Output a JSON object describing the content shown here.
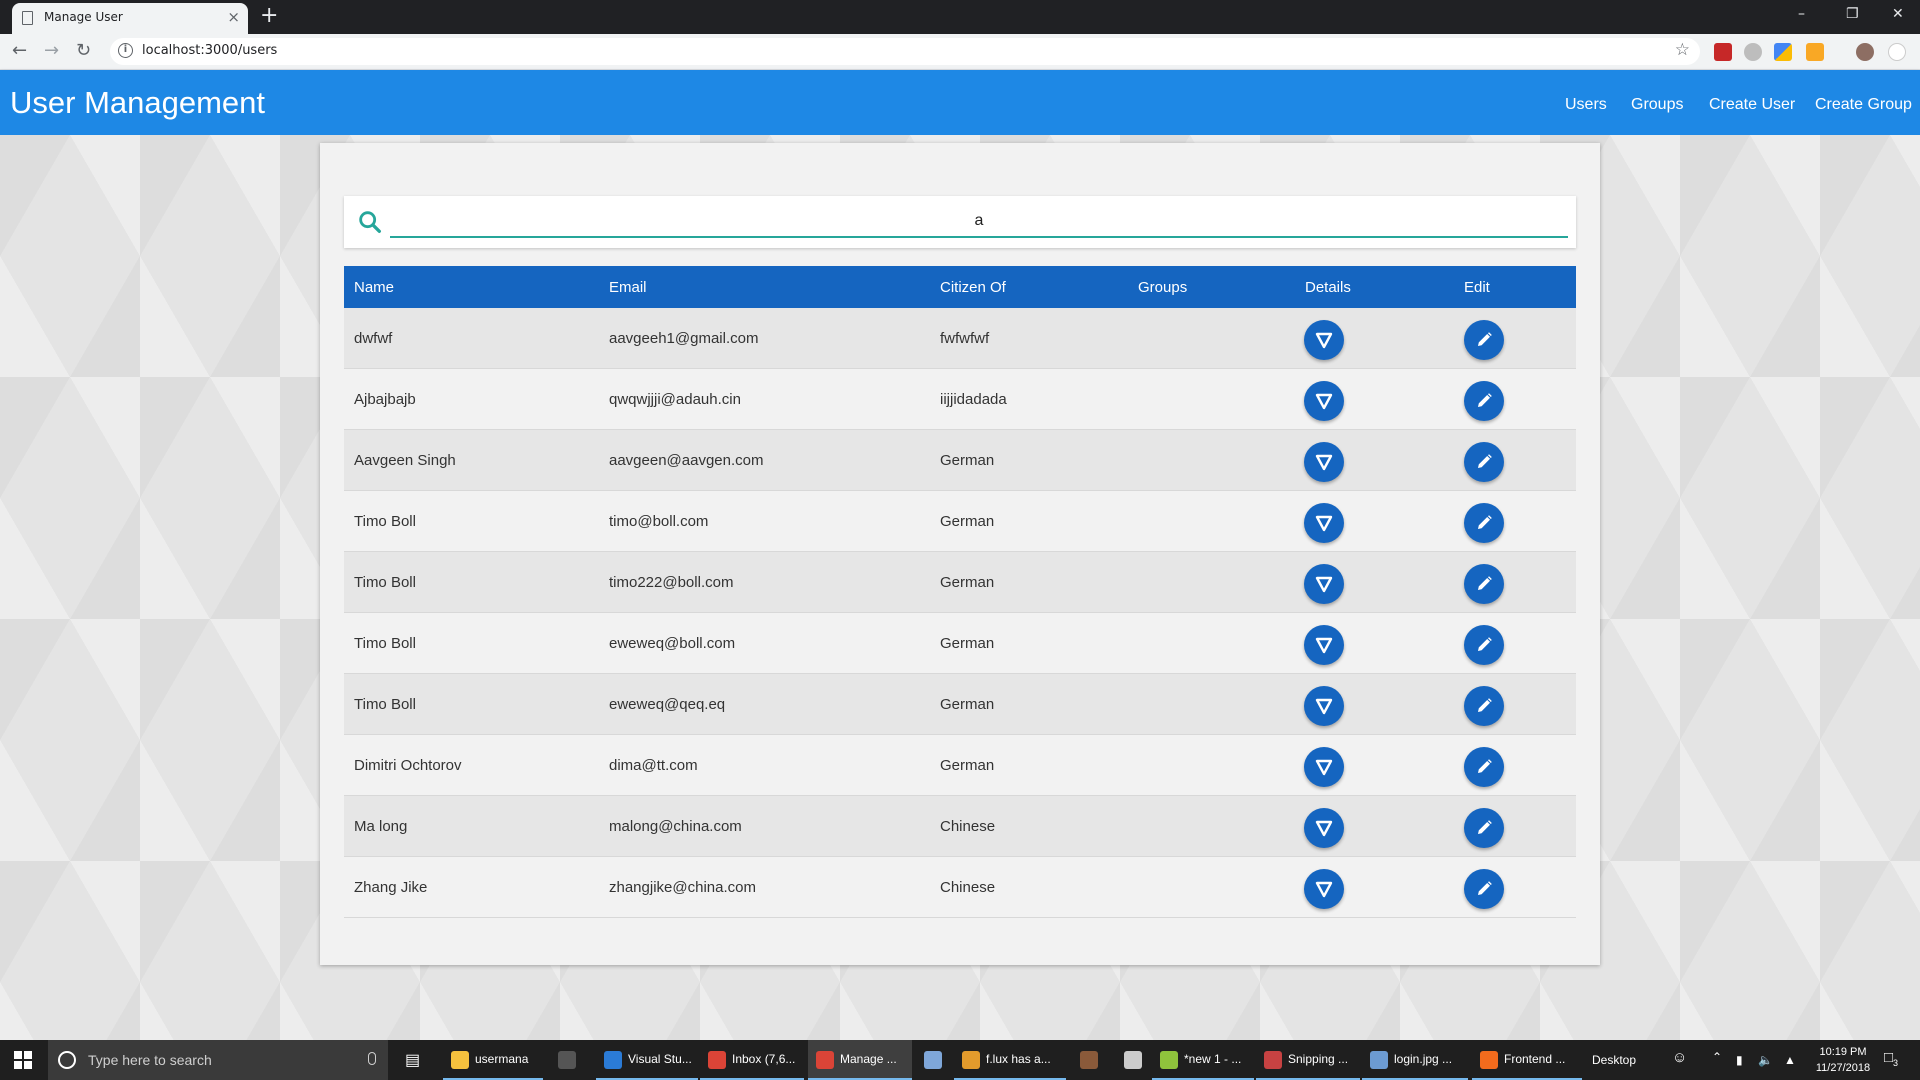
{
  "browser": {
    "tab_title": "Manage User",
    "tab_close": "×",
    "new_tab": "+",
    "url": "localhost:3000/users",
    "window_controls": [
      "–",
      "❐",
      "✕"
    ]
  },
  "app": {
    "title": "User Management",
    "nav": [
      "Users",
      "Groups",
      "Create User",
      "Create Group"
    ]
  },
  "search": {
    "value": "a",
    "placeholder": "",
    "icon": "search-icon",
    "accent_color": "#26a69a"
  },
  "table": {
    "headers": [
      "Name",
      "Email",
      "Citizen Of",
      "Groups",
      "Details",
      "Edit"
    ],
    "rows": [
      {
        "name": "dwfwf",
        "email": "aavgeeh1@gmail.com",
        "citizen": "fwfwfwf",
        "groups": ""
      },
      {
        "name": "Ajbajbajb",
        "email": "qwqwjjji@adauh.cin",
        "citizen": "iijjidadada",
        "groups": ""
      },
      {
        "name": "Aavgeen Singh",
        "email": "aavgeen@aavgen.com",
        "citizen": "German",
        "groups": ""
      },
      {
        "name": "Timo Boll",
        "email": "timo@boll.com",
        "citizen": "German",
        "groups": ""
      },
      {
        "name": "Timo Boll",
        "email": "timo222@boll.com",
        "citizen": "German",
        "groups": ""
      },
      {
        "name": "Timo Boll",
        "email": "eweweq@boll.com",
        "citizen": "German",
        "groups": ""
      },
      {
        "name": "Timo Boll",
        "email": "eweweq@qeq.eq",
        "citizen": "German",
        "groups": ""
      },
      {
        "name": "Dimitri Ochtorov",
        "email": "dima@tt.com",
        "citizen": "German",
        "groups": ""
      },
      {
        "name": "Ma long",
        "email": "malong@china.com",
        "citizen": "Chinese",
        "groups": ""
      },
      {
        "name": "Zhang Jike",
        "email": "zhangjike@china.com",
        "citizen": "Chinese",
        "groups": ""
      }
    ],
    "details_icon": "expand-triangle-icon",
    "edit_icon": "pencil-icon"
  },
  "colors": {
    "header_bg": "#1e88e5",
    "table_header_bg": "#1565c0",
    "button_bg": "#1565c0"
  },
  "taskbar": {
    "search_placeholder": "Type here to search",
    "items": [
      {
        "label": "usermana",
        "color": "#f6c23e"
      },
      {
        "label": "",
        "color": "#555555"
      },
      {
        "label": "Visual Stu...",
        "color": "#2b7bd6"
      },
      {
        "label": "Inbox (7,6...",
        "color": "#db4437"
      },
      {
        "label": "Manage ...",
        "color": "#db4437"
      },
      {
        "label": "",
        "color": "#7fa7d9"
      },
      {
        "label": "f.lux has a...",
        "color": "#e39b2c"
      },
      {
        "label": "",
        "color": "#8a5a3a"
      },
      {
        "label": "",
        "color": "#cccccc"
      },
      {
        "label": "*new 1 - ...",
        "color": "#8fc33c"
      },
      {
        "label": "Snipping ...",
        "color": "#c74242"
      },
      {
        "label": "login.jpg ...",
        "color": "#6c9bd2"
      },
      {
        "label": "Frontend ...",
        "color": "#f26b1d"
      }
    ],
    "desktop_label": "Desktop",
    "time": "10:19 PM",
    "date": "11/27/2018",
    "notifications": "3"
  }
}
